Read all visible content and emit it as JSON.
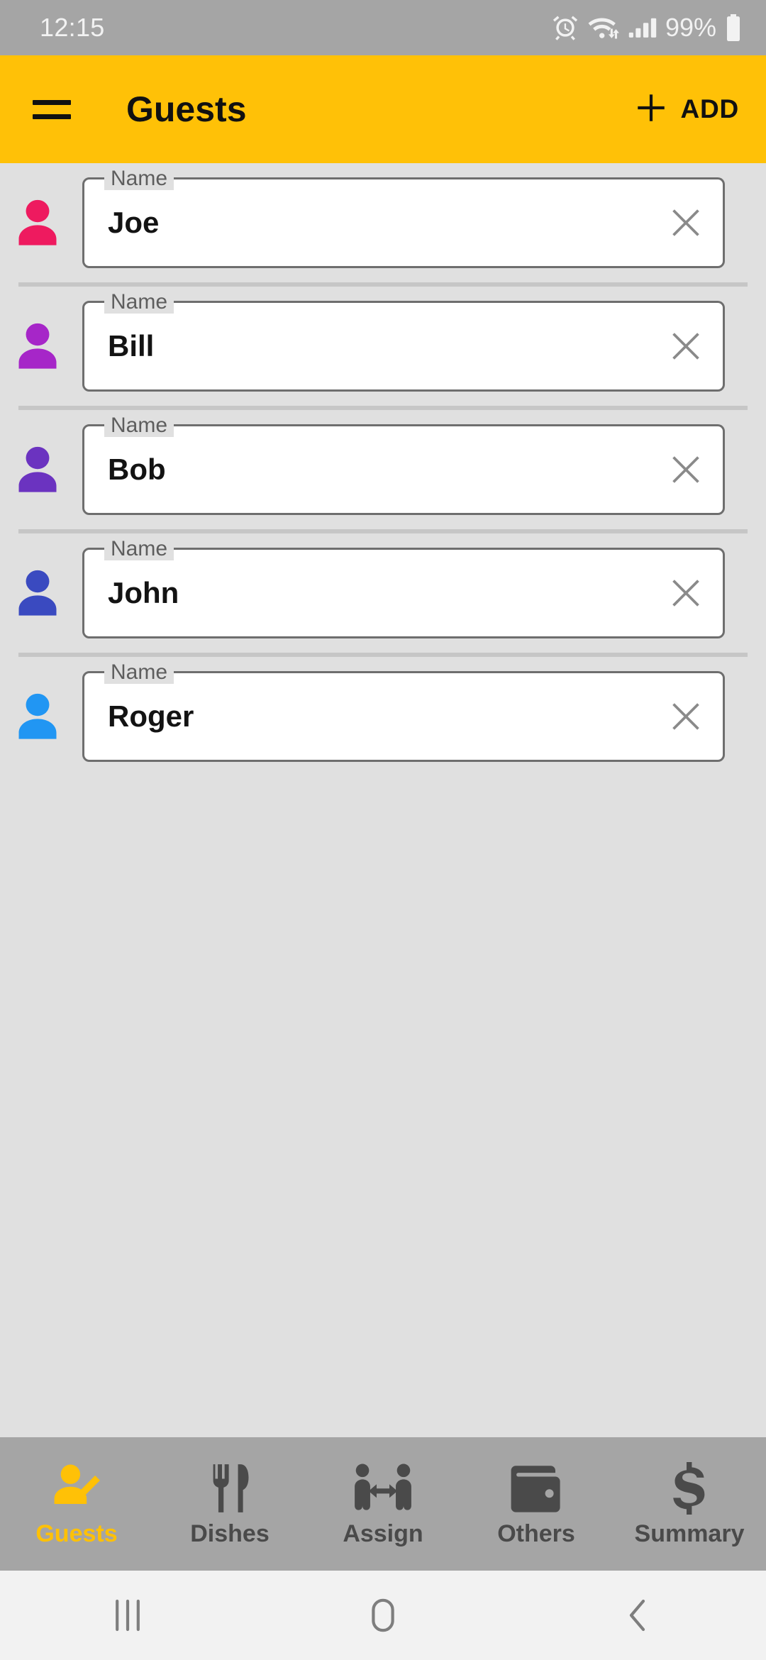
{
  "status_bar": {
    "clock": "12:15",
    "battery_percent": "99%",
    "icons": [
      "alarm-icon",
      "wifi-icon",
      "signal-icon",
      "battery-icon"
    ]
  },
  "app_bar": {
    "menu_icon": "hamburger-menu-icon",
    "title": "Guests",
    "add_icon": "plus-icon",
    "add_label": "ADD",
    "background_color": "#FFC107"
  },
  "guest_list": {
    "field_label": "Name",
    "clear_icon": "close-icon",
    "guests": [
      {
        "name": "Joe",
        "avatar_icon": "person-icon",
        "avatar_color": "#EE1A5F"
      },
      {
        "name": "Bill",
        "avatar_icon": "person-icon",
        "avatar_color": "#A626C8"
      },
      {
        "name": "Bob",
        "avatar_icon": "person-icon",
        "avatar_color": "#6B33C0"
      },
      {
        "name": "John",
        "avatar_icon": "person-icon",
        "avatar_color": "#3A4AC0"
      },
      {
        "name": "Roger",
        "avatar_icon": "person-icon",
        "avatar_color": "#2196F3"
      }
    ]
  },
  "bottom_nav": {
    "active_color": "#FFC107",
    "inactive_color": "#4A4A4A",
    "items": [
      {
        "label": "Guests",
        "icon": "person-edit-icon",
        "active": true
      },
      {
        "label": "Dishes",
        "icon": "fork-knife-icon",
        "active": false
      },
      {
        "label": "Assign",
        "icon": "assign-people-icon",
        "active": false
      },
      {
        "label": "Others",
        "icon": "wallet-icon",
        "active": false
      },
      {
        "label": "Summary",
        "icon": "dollar-icon",
        "active": false
      }
    ]
  },
  "system_nav": {
    "recents_icon": "recents-icon",
    "home_icon": "home-icon",
    "back_icon": "back-icon"
  }
}
